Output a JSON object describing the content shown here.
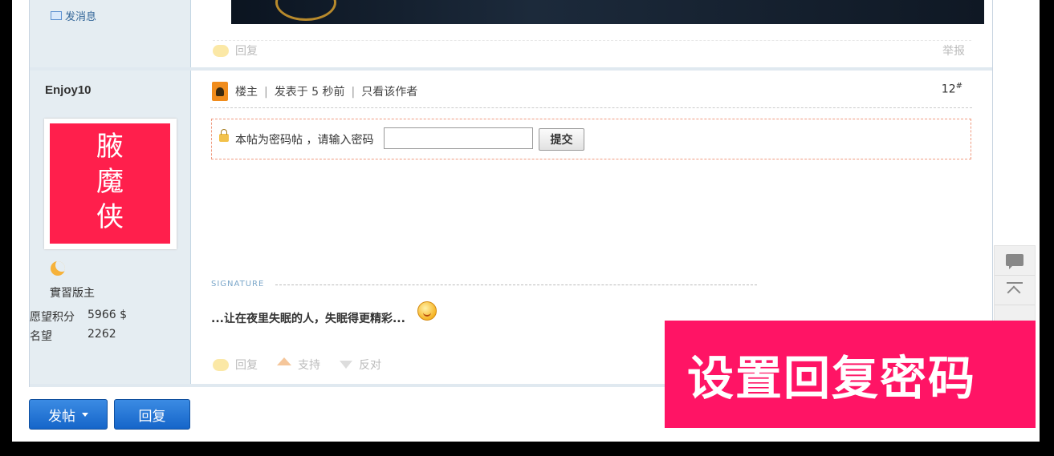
{
  "previous_post": {
    "send_message_link": "发消息",
    "reply_label": "回复",
    "report_label": "举报"
  },
  "post": {
    "author_name": "Enjoy10",
    "avatar_text": [
      "腋",
      "魔",
      "侠"
    ],
    "rank_title": "實習版主",
    "stats": [
      {
        "label": "愿望积分",
        "value": "5966 $"
      },
      {
        "label": "名望",
        "value": "2262"
      }
    ],
    "owner_label": "楼主",
    "posted_time": "发表于 5 秒前",
    "only_author_link": "只看该作者",
    "floor_number": "12",
    "floor_symbol": "#",
    "password_prompt": "本帖为密码帖 ，请输入密码",
    "password_value": "",
    "submit_label": "提交",
    "signature_label": "SIGNATURE",
    "signature_text": "...让在夜里失眠的人，失眠得更精彩...",
    "actions": {
      "reply": "回复",
      "support": "支持",
      "oppose": "反对"
    }
  },
  "bottom_buttons": {
    "new_post": "发帖",
    "reply": "回复"
  },
  "banner_text": "设置回复密码",
  "colors": {
    "banner_bg": "#ff1465",
    "button_blue": "#1565c9",
    "avatar_bg": "#ff1f4c",
    "sidebar_bg": "#e5edf2"
  }
}
